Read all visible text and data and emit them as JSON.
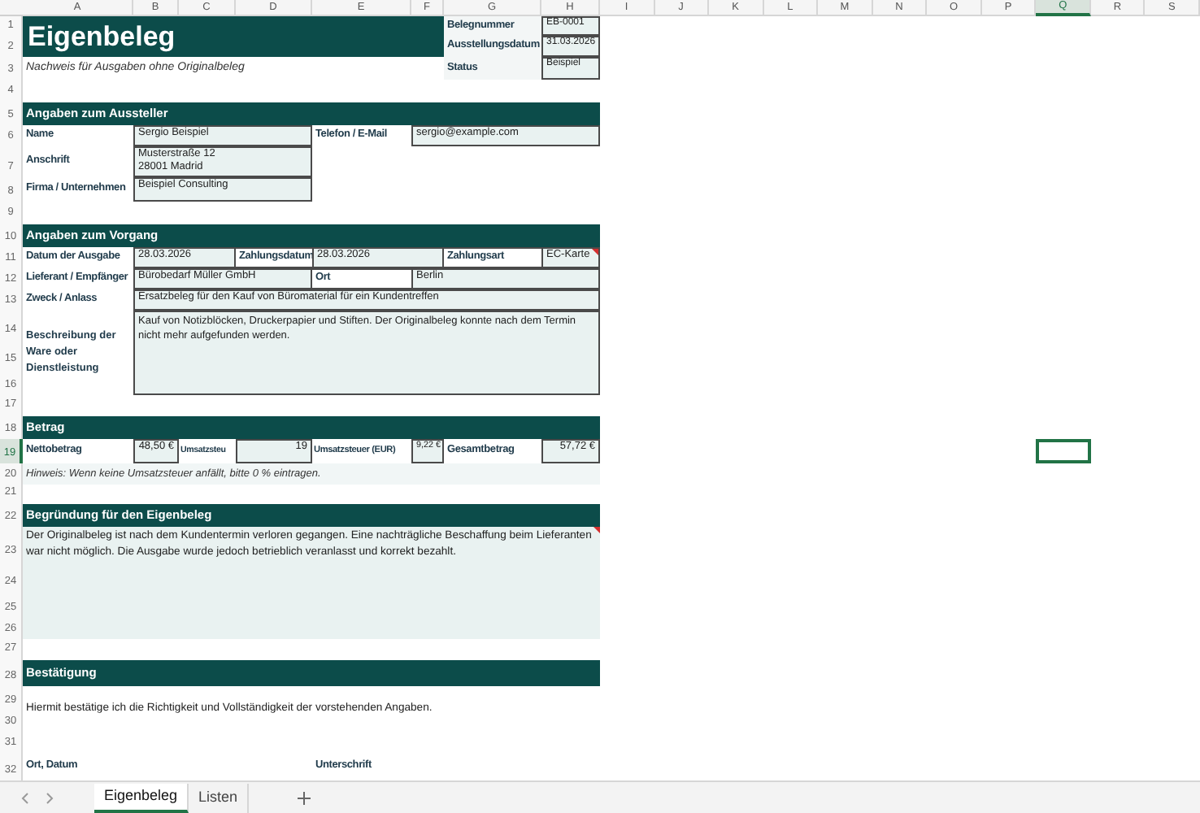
{
  "columns": [
    {
      "label": "A",
      "selected": false
    },
    {
      "label": "B",
      "selected": false
    },
    {
      "label": "C",
      "selected": false
    },
    {
      "label": "D",
      "selected": false
    },
    {
      "label": "E",
      "selected": false
    },
    {
      "label": "F",
      "selected": false
    },
    {
      "label": "G",
      "selected": false
    },
    {
      "label": "H",
      "selected": false
    },
    {
      "label": "I",
      "selected": false
    },
    {
      "label": "J",
      "selected": false
    },
    {
      "label": "K",
      "selected": false
    },
    {
      "label": "L",
      "selected": false
    },
    {
      "label": "M",
      "selected": false
    },
    {
      "label": "N",
      "selected": false
    },
    {
      "label": "O",
      "selected": false
    },
    {
      "label": "P",
      "selected": false
    },
    {
      "label": "Q",
      "selected": true
    },
    {
      "label": "R",
      "selected": false
    },
    {
      "label": "S",
      "selected": false
    }
  ],
  "rows": [
    {
      "label": "1",
      "selected": false
    },
    {
      "label": "2",
      "selected": false
    },
    {
      "label": "3",
      "selected": false
    },
    {
      "label": "4",
      "selected": false
    },
    {
      "label": "5",
      "selected": false
    },
    {
      "label": "6",
      "selected": false
    },
    {
      "label": "7",
      "selected": false
    },
    {
      "label": "8",
      "selected": false
    },
    {
      "label": "9",
      "selected": false
    },
    {
      "label": "10",
      "selected": false
    },
    {
      "label": "11",
      "selected": false
    },
    {
      "label": "12",
      "selected": false
    },
    {
      "label": "13",
      "selected": false
    },
    {
      "label": "14",
      "selected": false
    },
    {
      "label": "15",
      "selected": false
    },
    {
      "label": "16",
      "selected": false
    },
    {
      "label": "17",
      "selected": false
    },
    {
      "label": "18",
      "selected": false
    },
    {
      "label": "19",
      "selected": true
    },
    {
      "label": "20",
      "selected": false
    },
    {
      "label": "21",
      "selected": false
    },
    {
      "label": "22",
      "selected": false
    },
    {
      "label": "23",
      "selected": false
    },
    {
      "label": "24",
      "selected": false
    },
    {
      "label": "25",
      "selected": false
    },
    {
      "label": "26",
      "selected": false
    },
    {
      "label": "27",
      "selected": false
    },
    {
      "label": "28",
      "selected": false
    },
    {
      "label": "29",
      "selected": false
    },
    {
      "label": "30",
      "selected": false
    },
    {
      "label": "31",
      "selected": false
    },
    {
      "label": "32",
      "selected": false
    }
  ],
  "title": "Eigenbeleg",
  "subtitle": "Nachweis für Ausgaben ohne Originalbeleg",
  "meta": [
    {
      "label": "Belegnummer",
      "value": "EB-0001"
    },
    {
      "label": "Ausstellungsdatum",
      "value": "31.03.2026"
    },
    {
      "label": "Status",
      "value": "Beispiel"
    }
  ],
  "aussteller": {
    "heading": "Angaben zum Aussteller",
    "name_label": "Name",
    "name": "Sergio Beispiel",
    "contact_label": "Telefon / E-Mail",
    "contact": "sergio@example.com",
    "address_label": "Anschrift",
    "address": [
      "Musterstraße 12",
      "28001 Madrid"
    ],
    "company_label": "Firma / Unternehmen",
    "company": "Beispiel Consulting"
  },
  "vorgang": {
    "heading": "Angaben zum Vorgang",
    "date_label": "Datum der Ausgabe",
    "date": "28.03.2026",
    "paydate_label": "Zahlungsdatum",
    "paydate": "28.03.2026",
    "paytype_label": "Zahlungsart",
    "paytype": "EC-Karte",
    "supplier_label": "Lieferant / Empfänger",
    "supplier": "Bürobedarf Müller GmbH",
    "place_label": "Ort",
    "place": "Berlin",
    "purpose_label": "Zweck / Anlass",
    "purpose": "Ersatzbeleg für den Kauf von Büromaterial für ein Kundentreffen",
    "description_label": "Beschreibung der Ware oder Dienstleistung",
    "description": "Kauf von Notizblöcken, Druckerpapier und Stiften. Der Originalbeleg konnte nach dem Termin nicht mehr aufgefunden werden."
  },
  "betrag": {
    "heading": "Betrag",
    "net_label": "Nettobetrag",
    "net": "48,50 €",
    "vat_rate_label": "Umsatzsteu",
    "vat_rate": "19",
    "vat_label": "Umsatzsteuer (EUR)",
    "vat": "9,22 €",
    "total_label": "Gesamtbetrag",
    "total": "57,72 €",
    "hint": "Hinweis: Wenn keine Umsatzsteuer anfällt, bitte 0 % eintragen."
  },
  "begruendung": {
    "heading": "Begründung für den Eigenbeleg",
    "text": "Der Originalbeleg ist nach dem Kundentermin verloren gegangen. Eine nachträgliche Beschaffung beim Lieferanten war nicht möglich. Die Ausgabe wurde jedoch betrieblich veranlasst und korrekt bezahlt."
  },
  "bestaetigung": {
    "heading": "Bestätigung",
    "text": "Hiermit bestätige ich die Richtigkeit und Vollständigkeit der vorstehenden Angaben.",
    "place_date_label": "Ort, Datum",
    "signature_label": "Unterschrift"
  },
  "sheet_tabs": [
    {
      "label": "Eigenbeleg",
      "selected": true
    },
    {
      "label": "Listen",
      "selected": false
    }
  ]
}
